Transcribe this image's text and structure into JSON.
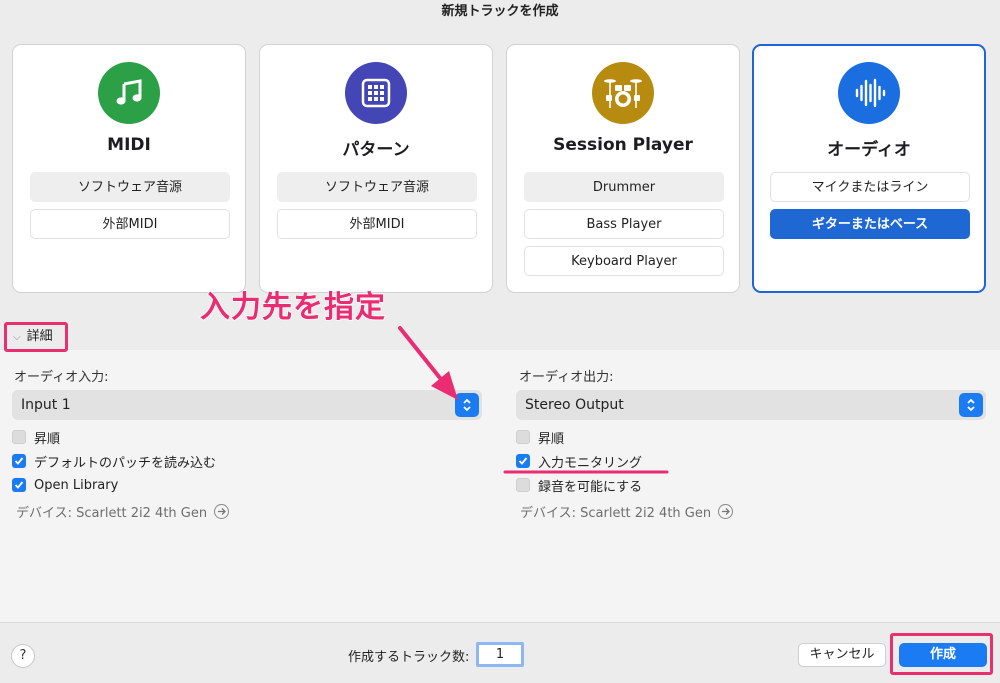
{
  "window": {
    "title": "新規トラックを作成"
  },
  "cards": [
    {
      "title": "MIDI",
      "icon": "music-note-icon",
      "color": "#2ba047",
      "options": [
        {
          "label": "ソフトウェア音源",
          "style": "shaded"
        },
        {
          "label": "外部MIDI",
          "style": "plain"
        }
      ]
    },
    {
      "title": "パターン",
      "icon": "grid-icon",
      "color": "#4346b4",
      "options": [
        {
          "label": "ソフトウェア音源",
          "style": "shaded"
        },
        {
          "label": "外部MIDI",
          "style": "plain"
        }
      ]
    },
    {
      "title": "Session Player",
      "icon": "drum-kit-icon",
      "color": "#b78b0f",
      "options": [
        {
          "label": "Drummer",
          "style": "shaded"
        },
        {
          "label": "Bass Player",
          "style": "plain"
        },
        {
          "label": "Keyboard Player",
          "style": "plain"
        }
      ]
    },
    {
      "title": "オーディオ",
      "icon": "waveform-icon",
      "color": "#1a6ee0",
      "selected": true,
      "options": [
        {
          "label": "マイクまたはライン",
          "style": "plain"
        },
        {
          "label": "ギターまたはベース",
          "style": "primary"
        }
      ]
    }
  ],
  "details": {
    "toggle_label": "詳細",
    "input": {
      "label": "オーディオ入力:",
      "value": "Input 1",
      "checkboxes": [
        {
          "label": "昇順",
          "checked": false
        },
        {
          "label": "デフォルトのパッチを読み込む",
          "checked": true
        },
        {
          "label": "Open Library",
          "checked": true
        }
      ],
      "device": "デバイス: Scarlett 2i2 4th Gen"
    },
    "output": {
      "label": "オーディオ出力:",
      "value": "Stereo Output",
      "checkboxes": [
        {
          "label": "昇順",
          "checked": false
        },
        {
          "label": "入力モニタリング",
          "checked": true
        },
        {
          "label": "録音を可能にする",
          "checked": false
        }
      ],
      "device": "デバイス: Scarlett 2i2 4th Gen"
    }
  },
  "footer": {
    "help": "?",
    "count_label": "作成するトラック数:",
    "count_value": "1",
    "cancel": "キャンセル",
    "create": "作成"
  },
  "annotation": {
    "text": "入力先を指定",
    "color": "#ea2c72"
  }
}
